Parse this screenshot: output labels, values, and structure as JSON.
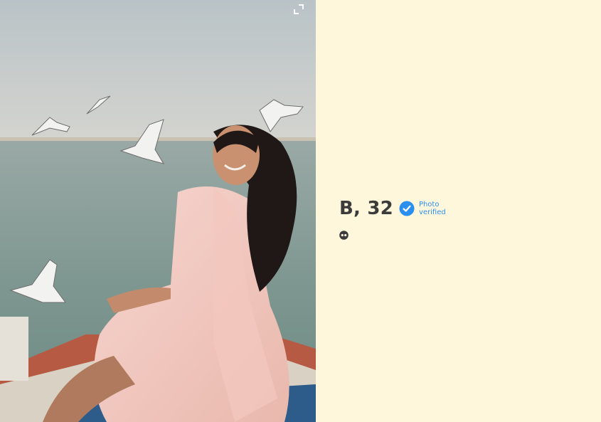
{
  "profile": {
    "name_age": "B, 32",
    "verified_label": "Photo verified"
  },
  "icons": {
    "expand": "expand-icon",
    "verified": "verified-check-icon",
    "secondary": "dots-icon"
  },
  "colors": {
    "background": "#fff7dc",
    "accent": "#2b8ff0",
    "text": "#3b3b3b"
  }
}
